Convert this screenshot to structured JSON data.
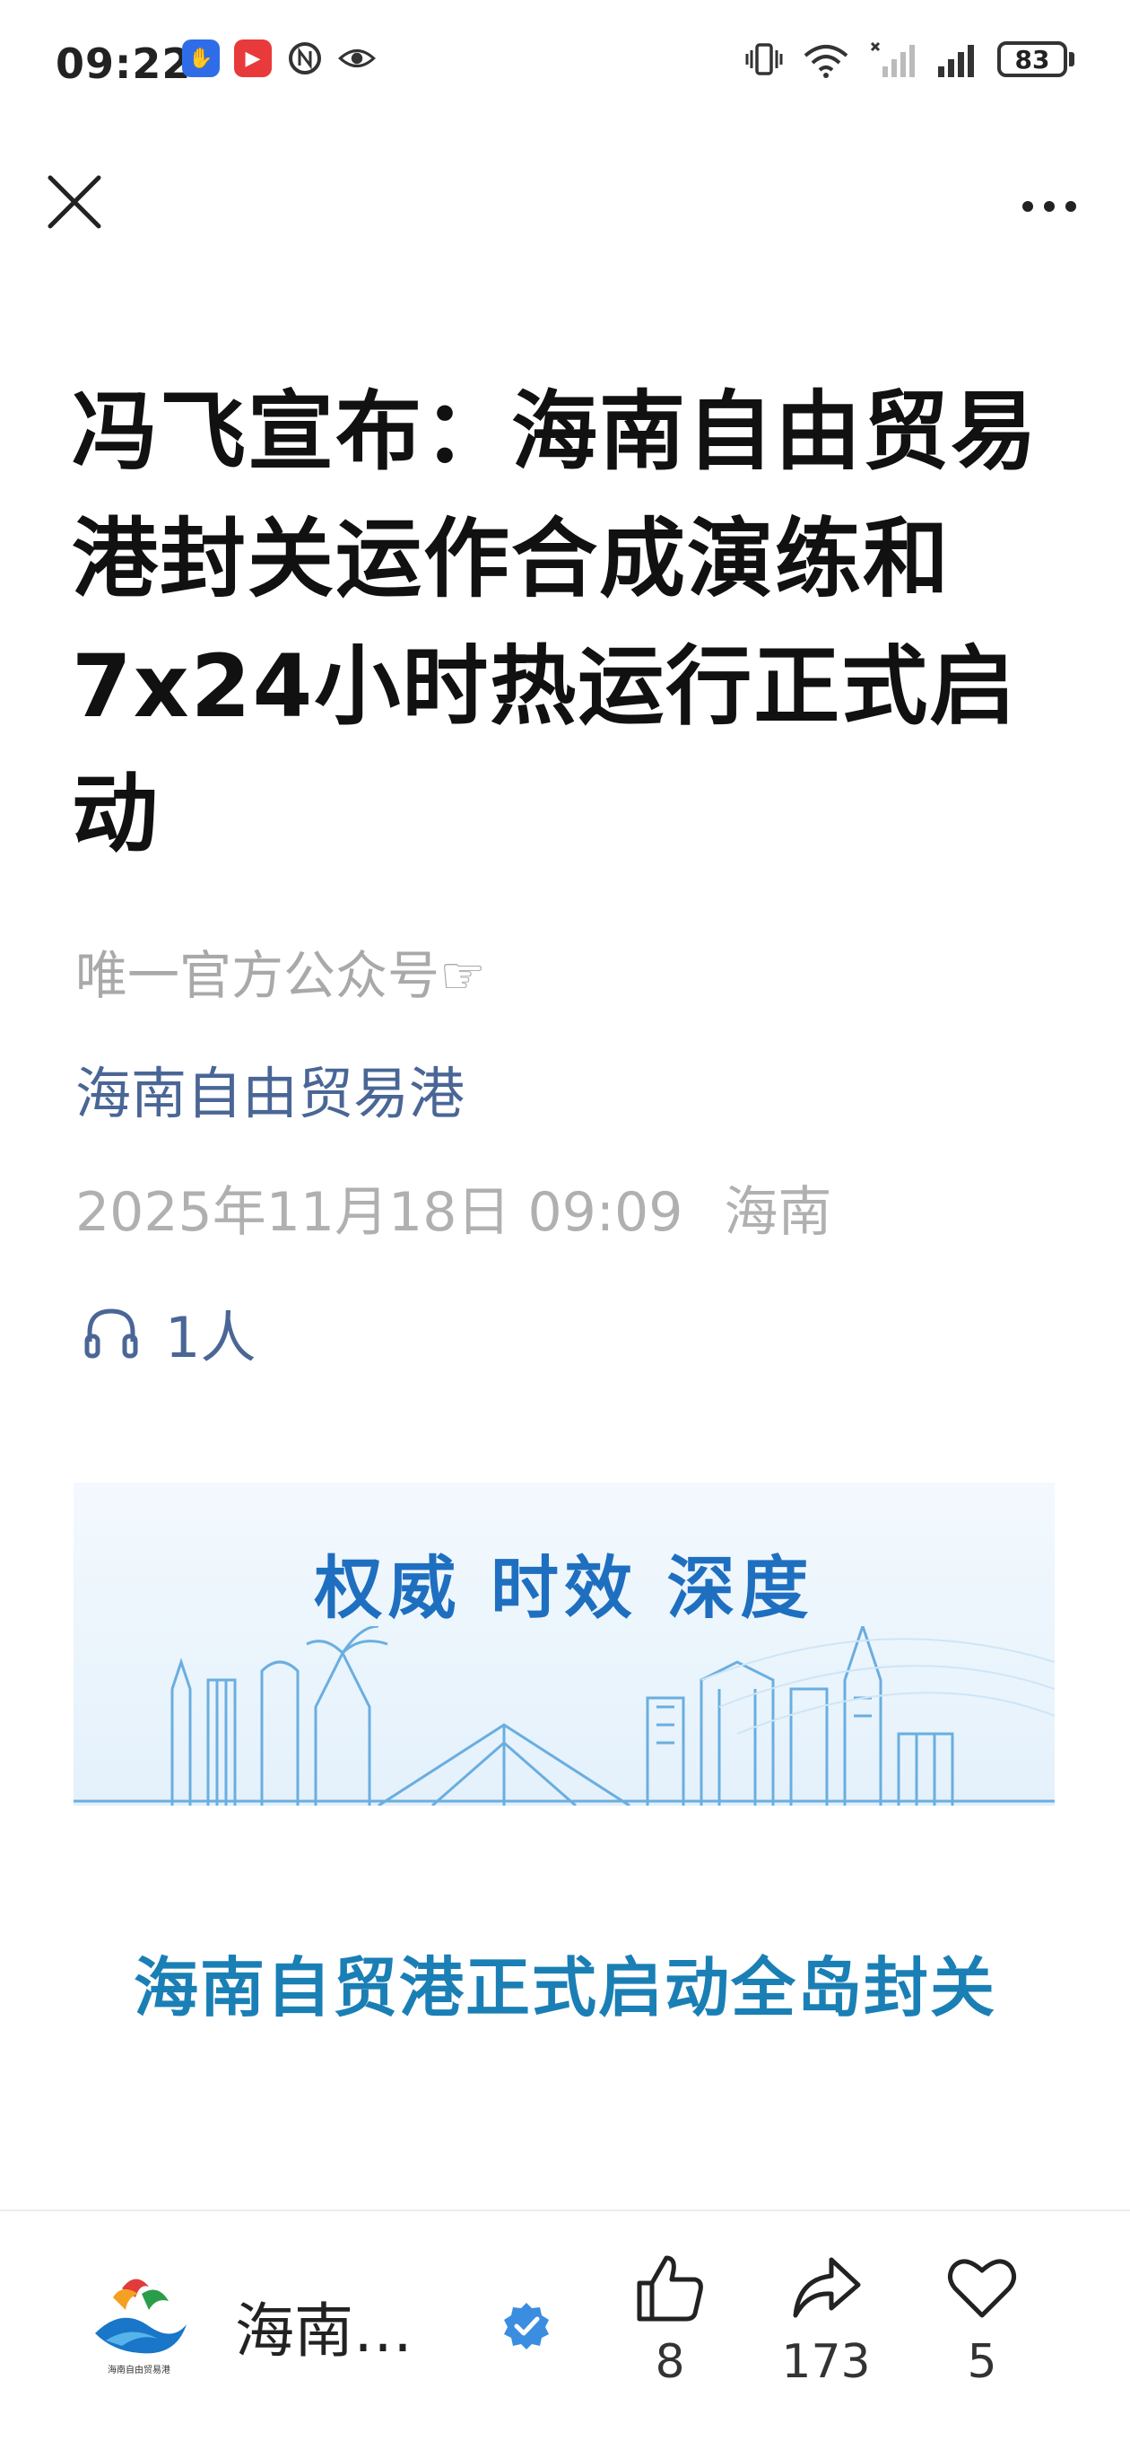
{
  "status_bar": {
    "time": "09:22",
    "battery": "83",
    "icons": [
      "app-blue-icon",
      "app-red-icon",
      "nfc-icon",
      "eye-icon",
      "vibrate-icon",
      "wifi-icon",
      "signal-sim2-icon",
      "signal-sim1-icon",
      "battery-icon"
    ]
  },
  "nav": {
    "close_icon": "close-icon",
    "more_icon": "more-icon"
  },
  "article": {
    "title": "冯飞宣布：海南自由贸易港封关运作合成演练和7x24小时热运行正式启动",
    "tagline": "唯一官方公众号☞",
    "account_name": "海南自由贸易港",
    "date": "2025年11月18日 09:09",
    "location": "海南",
    "listeners": "1人",
    "banner_slogan": "权威  时效  深度",
    "subhead": "海南自贸港正式启动全岛封关"
  },
  "bottom_bar": {
    "account_short": "海南…",
    "logo_caption": "海南自由贸易港",
    "likes": "8",
    "shares": "173",
    "favorites": "5"
  },
  "colors": {
    "account_link": "#4a6696",
    "subhead": "#1a7fb5",
    "banner_text": "#1f6fc0",
    "muted": "#b0b0b0"
  }
}
